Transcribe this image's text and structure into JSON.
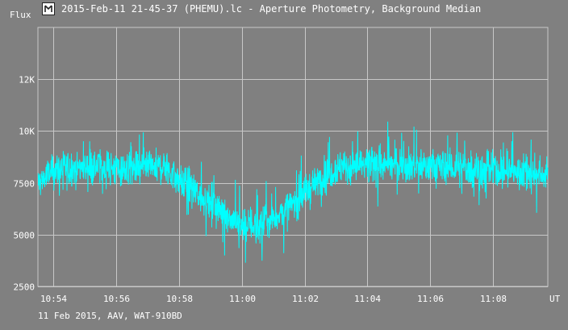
{
  "window": {
    "title": "2015-Feb-11 21-45-37 (PHEMU).lc - Aperture Photometry, Background Median",
    "icon": "app-logo-icon"
  },
  "footer": {
    "info": "11 Feb 2015, AAV, WAT-910BD"
  },
  "colors": {
    "background": "#808080",
    "grid": "#c8c8c8",
    "series": "#00ffff",
    "text": "#ffffff"
  },
  "chart_data": {
    "type": "line",
    "ylabel": "Flux",
    "xlabel": "UT",
    "x_ticks": [
      "10:54",
      "10:56",
      "10:58",
      "11:00",
      "11:02",
      "11:04",
      "11:06",
      "11:08"
    ],
    "y_ticks": [
      "2500",
      "5000",
      "7500",
      "10K",
      "12K"
    ],
    "y_tick_values": [
      2500,
      5000,
      7500,
      10000,
      12500
    ],
    "xlim": [
      "10:53:30",
      "11:09:45"
    ],
    "ylim": [
      2500,
      15000
    ],
    "grid": true,
    "legend": "none",
    "series": [
      {
        "x": [
          "10:53:30",
          "10:54:00",
          "10:54:30",
          "10:55:00",
          "10:55:30",
          "10:56:00",
          "10:56:30",
          "10:57:00",
          "10:57:30",
          "10:58:00",
          "10:58:30",
          "10:59:00",
          "10:59:30",
          "10:59:45",
          "11:00:00",
          "11:00:30",
          "11:01:00",
          "11:01:30",
          "11:02:00",
          "11:02:30",
          "11:03:00",
          "11:03:30",
          "11:04:00",
          "11:05:00",
          "11:06:00",
          "11:07:00",
          "11:08:00",
          "11:09:00",
          "11:09:45"
        ],
        "values": [
          7500,
          8100,
          8200,
          8300,
          8300,
          8200,
          8100,
          8200,
          8300,
          7600,
          7100,
          6500,
          6000,
          5700,
          5500,
          5400,
          5800,
          6300,
          7000,
          7700,
          8200,
          8300,
          8300,
          8400,
          8300,
          8200,
          8100,
          8000,
          7900
        ]
      }
    ]
  }
}
